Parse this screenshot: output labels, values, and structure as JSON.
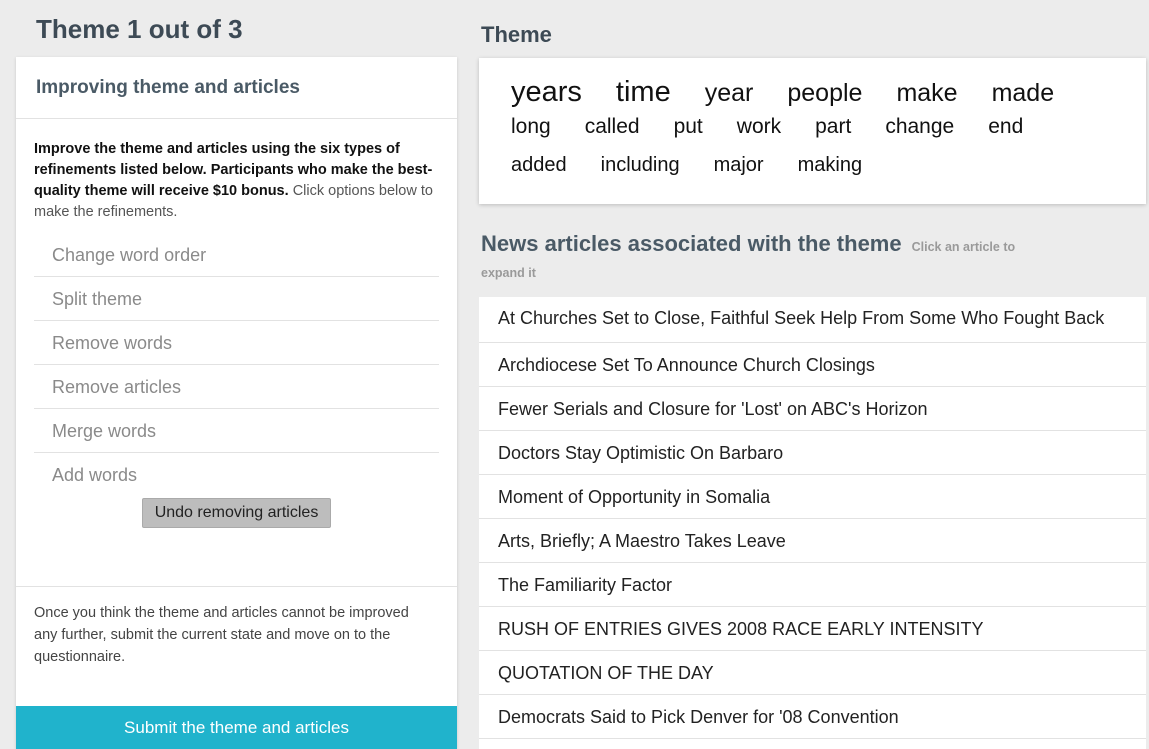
{
  "page": {
    "title": "Theme 1 out of 3"
  },
  "refine_panel": {
    "header": "Improving theme and articles",
    "instructions_bold": "Improve the theme and articles using the six types of refinements listed below. Participants who make the best-quality theme will receive $10 bonus.",
    "instructions_normal": "Click options below to make the refinements.",
    "options": [
      "Change word order",
      "Split theme",
      "Remove words",
      "Remove articles",
      "Merge words",
      "Add words"
    ],
    "undo_label": "Undo removing articles",
    "final_note": "Once you think the theme and articles cannot be improved any further, submit the current state and move on to the questionnaire.",
    "submit_label": "Submit the theme and articles"
  },
  "theme": {
    "heading": "Theme",
    "words": [
      "years",
      "time",
      "year",
      "people",
      "make",
      "made",
      "long",
      "called",
      "put",
      "work",
      "part",
      "change",
      "end",
      "added",
      "including",
      "major",
      "making"
    ]
  },
  "articles": {
    "heading": "News articles associated with the theme",
    "hint_part1": "Click an article to",
    "hint_part2": "expand it",
    "items": [
      "At Churches Set to Close, Faithful Seek Help From Some Who Fought Back",
      "Archdiocese Set To Announce Church Closings",
      "Fewer Serials and Closure for 'Lost' on ABC's Horizon",
      "Doctors Stay Optimistic On Barbaro",
      "Moment of Opportunity in Somalia",
      "Arts, Briefly; A Maestro Takes Leave",
      "The Familiarity Factor",
      "RUSH OF ENTRIES GIVES 2008 RACE EARLY INTENSITY",
      "QUOTATION OF THE DAY",
      "Democrats Said to Pick Denver for '08 Convention"
    ]
  },
  "colors": {
    "submit_bg": "#20b3cc",
    "page_bg": "#ececec"
  }
}
